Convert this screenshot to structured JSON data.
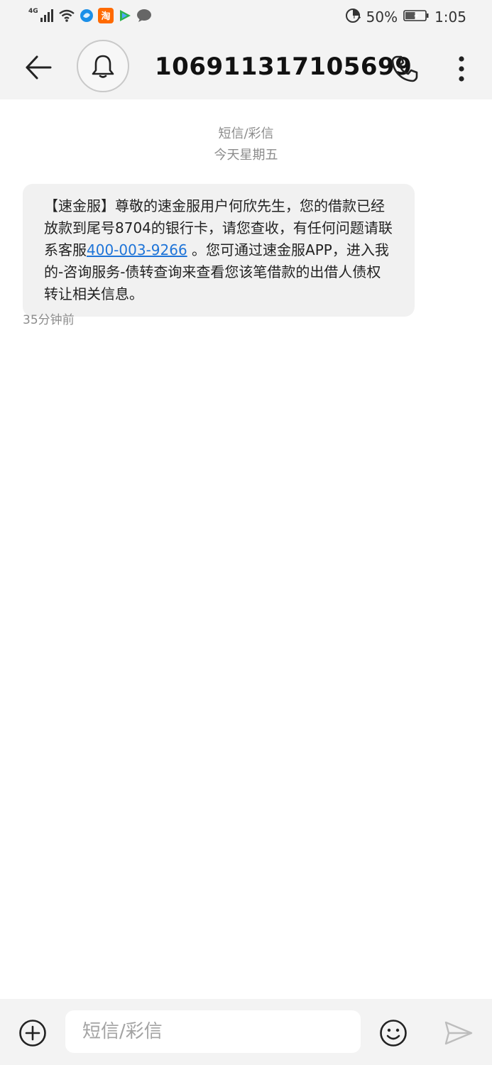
{
  "status_bar": {
    "network": "4G",
    "battery_percent": "50%",
    "battery_level": 0.5,
    "time": "1:05",
    "icons": [
      "signal-icon",
      "wifi-icon",
      "browser-app-icon",
      "taobao-app-icon",
      "video-app-icon",
      "chat-app-icon",
      "data-saver-icon",
      "battery-icon"
    ]
  },
  "header": {
    "title": "106911317105699",
    "icons": [
      "back-arrow-icon",
      "bell-icon",
      "phone-icon",
      "more-vertical-icon"
    ]
  },
  "conversation": {
    "message_type": "短信/彩信",
    "date": "今天星期五",
    "message": {
      "text_before_link": "【速金服】尊敬的速金服用户何欣先生，您的借款已经放款到尾号8704的银行卡，请您查收，有任何问题请联系客服",
      "link": "400-003-9266",
      "text_after_link": " 。您可通过速金服APP，进入我的-咨询服务-债转查询来查看您该笔借款的出借人债权转让相关信息。",
      "time": "35分钟前"
    }
  },
  "composer": {
    "placeholder": "短信/彩信",
    "icons": [
      "add-icon",
      "emoji-icon",
      "send-icon"
    ]
  },
  "colors": {
    "bar_background": "#f3f3f3",
    "bubble_background": "#f1f1f1",
    "link": "#1e74d8",
    "muted_text": "#8c8c8c"
  }
}
